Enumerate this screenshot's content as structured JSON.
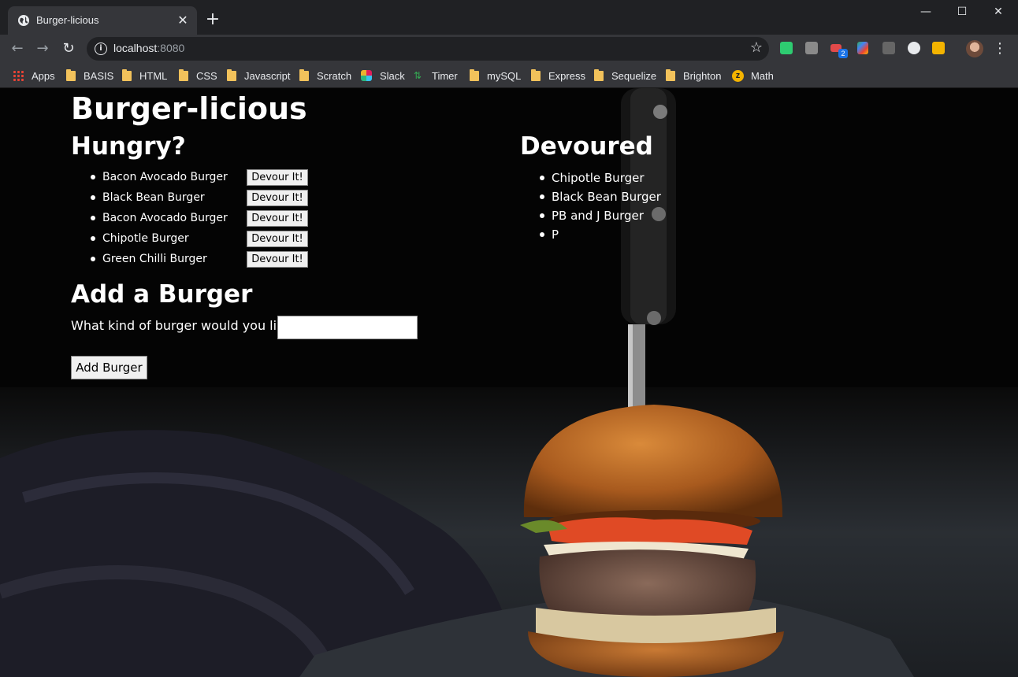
{
  "browser": {
    "tab_title": "Burger-licious",
    "tab_close": "✕",
    "new_tab": "+",
    "window_controls": {
      "minimize": "—",
      "maximize": "☐",
      "close": "✕"
    },
    "url_host": "localhost",
    "url_port": ":8080",
    "bookmarks": [
      {
        "label": "Apps",
        "icon": "apps-grid-icon"
      },
      {
        "label": "BASIS",
        "icon": "folder-icon"
      },
      {
        "label": "HTML",
        "icon": "folder-icon"
      },
      {
        "label": "CSS",
        "icon": "folder-icon"
      },
      {
        "label": "Javascript",
        "icon": "folder-icon"
      },
      {
        "label": "Scratch",
        "icon": "folder-icon"
      },
      {
        "label": "Slack",
        "icon": "slack-icon"
      },
      {
        "label": "Timer",
        "icon": "timer-icon"
      },
      {
        "label": "mySQL",
        "icon": "folder-icon"
      },
      {
        "label": "Express",
        "icon": "folder-icon"
      },
      {
        "label": "Sequelize",
        "icon": "folder-icon"
      },
      {
        "label": "Brighton",
        "icon": "folder-icon"
      },
      {
        "label": "Math",
        "icon": "math-icon"
      }
    ],
    "extension_badge": "2"
  },
  "page": {
    "title": "Burger-licious",
    "hungry": {
      "heading": "Hungry?",
      "devour_label": "Devour It!",
      "items": [
        "Bacon Avocado Burger",
        "Black Bean Burger",
        "Bacon Avocado Burger",
        "Chipotle Burger",
        "Green Chilli Burger"
      ]
    },
    "devoured": {
      "heading": "Devoured",
      "items": [
        "Chipotle Burger",
        "Black Bean Burger",
        "PB and J Burger",
        "P"
      ]
    },
    "add": {
      "heading": "Add a Burger",
      "label": "What kind of burger would you like?",
      "input_value": "",
      "button_label": "Add Burger"
    }
  }
}
